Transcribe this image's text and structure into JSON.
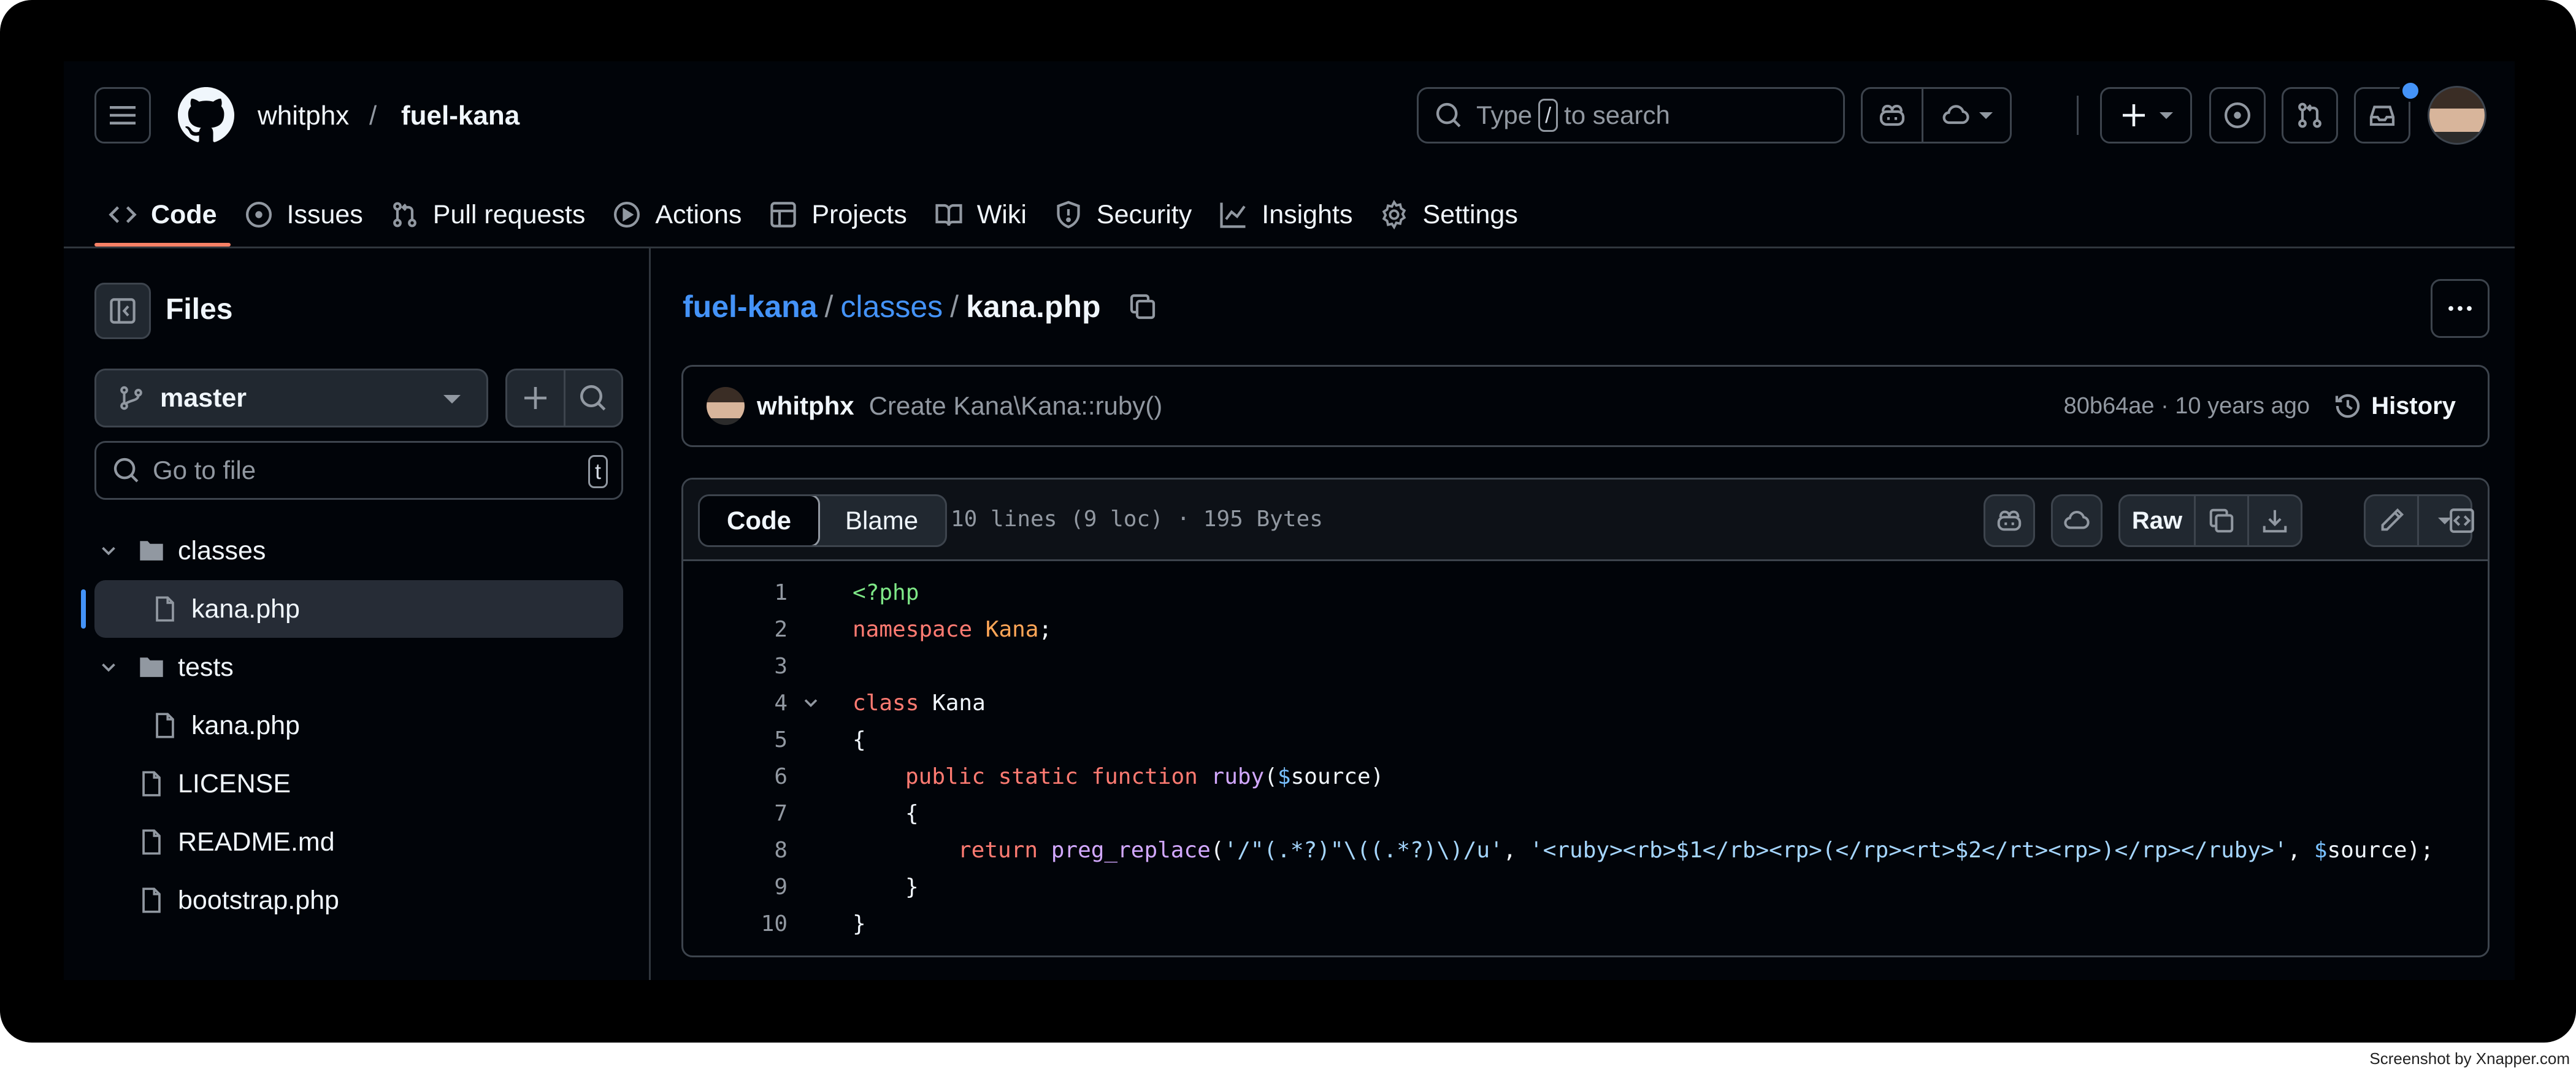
{
  "header": {
    "owner": "whitphx",
    "separator": "/",
    "repo": "fuel-kana",
    "search": {
      "prefix": "Type",
      "key": "/",
      "suffix": "to search"
    }
  },
  "tabs": [
    {
      "label": "Code",
      "icon": "code-icon",
      "active": true
    },
    {
      "label": "Issues",
      "icon": "issue-icon"
    },
    {
      "label": "Pull requests",
      "icon": "pull-request-icon"
    },
    {
      "label": "Actions",
      "icon": "play-icon"
    },
    {
      "label": "Projects",
      "icon": "table-icon"
    },
    {
      "label": "Wiki",
      "icon": "book-icon"
    },
    {
      "label": "Security",
      "icon": "shield-icon"
    },
    {
      "label": "Insights",
      "icon": "graph-icon"
    },
    {
      "label": "Settings",
      "icon": "gear-icon"
    }
  ],
  "sidebar": {
    "title": "Files",
    "branch": "master",
    "goto_placeholder": "Go to file",
    "goto_key": "t",
    "tree": [
      {
        "label": "classes",
        "type": "folder"
      },
      {
        "label": "kana.php",
        "type": "file",
        "selected": true
      },
      {
        "label": "tests",
        "type": "folder"
      },
      {
        "label": "kana.php",
        "type": "file"
      },
      {
        "label": "LICENSE",
        "type": "file"
      },
      {
        "label": "README.md",
        "type": "file"
      },
      {
        "label": "bootstrap.php",
        "type": "file"
      }
    ]
  },
  "breadcrumb": {
    "repo": "fuel-kana",
    "dir": "classes",
    "sep": "/",
    "file": "kana.php"
  },
  "commit": {
    "author": "whitphx",
    "message": "Create Kana\\Kana::ruby()",
    "meta": "80b64ae · 10 years ago",
    "history_label": "History"
  },
  "viewer": {
    "tab_code": "Code",
    "tab_blame": "Blame",
    "info": "10 lines (9 loc) · 195 Bytes",
    "raw_label": "Raw"
  },
  "code": {
    "line_numbers": [
      "1",
      "2",
      "3",
      "4",
      "5",
      "6",
      "7",
      "8",
      "9",
      "10"
    ],
    "l1": "<?php",
    "l2_kw": "namespace",
    "l2_name": "Kana",
    "l2_end": ";",
    "l4_kw": "class",
    "l4_name": " Kana",
    "l5": "{",
    "l6_kw": "public static function",
    "l6_fn": "ruby",
    "l6_open": "(",
    "l6_var": "$",
    "l6_name": "source",
    "l6_close": ")",
    "l7": "{",
    "l8_kw": "return",
    "l8_fn": "preg_replace",
    "l8_open": "(",
    "l8_str1": "'/\"(.*?)\"\\((.*?)\\)/u'",
    "l8_comma1": ", ",
    "l8_str2": "'<ruby><rb>$1</rb><rp>(</rp><rt>$2</rt><rp>)</rp></ruby>'",
    "l8_comma2": ", ",
    "l8_var": "$",
    "l8_name": "source",
    "l8_end": ");",
    "l9": "}",
    "l10": "}"
  },
  "watermark": "Screenshot by Xnapper.com"
}
